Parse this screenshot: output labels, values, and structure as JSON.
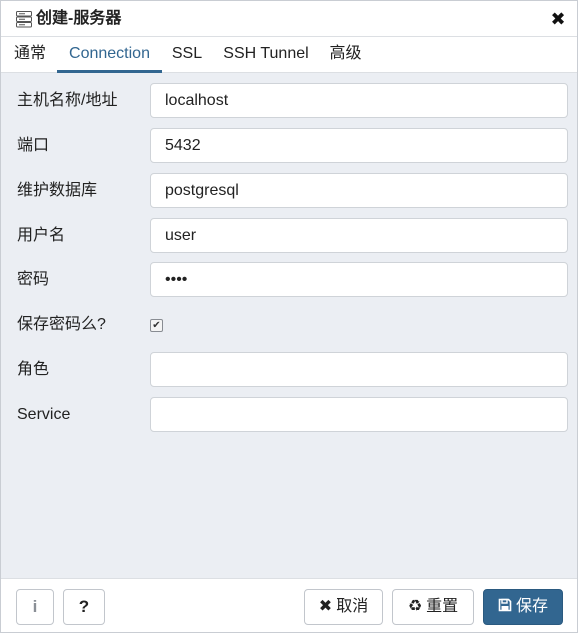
{
  "dialog": {
    "title": "创建-服务器",
    "icon": "server-icon",
    "close_icon": "close-icon"
  },
  "tabs": [
    {
      "label": "通常",
      "active": false
    },
    {
      "label": "Connection",
      "active": true
    },
    {
      "label": "SSL",
      "active": false
    },
    {
      "label": "SSH Tunnel",
      "active": false
    },
    {
      "label": "高级",
      "active": false
    }
  ],
  "form": {
    "host": {
      "label": "主机名称/地址",
      "value": "localhost"
    },
    "port": {
      "label": "端口",
      "value": "5432"
    },
    "maintenance_db": {
      "label": "维护数据库",
      "value": "postgresql"
    },
    "username": {
      "label": "用户名",
      "value": "user"
    },
    "password": {
      "label": "密码",
      "value": "••••"
    },
    "save_password": {
      "label": "保存密码么?",
      "checked": true
    },
    "role": {
      "label": "角色",
      "value": ""
    },
    "service": {
      "label": "Service",
      "value": ""
    }
  },
  "footer": {
    "info_icon": "info-icon",
    "help_icon": "help-icon",
    "help_label": "?",
    "info_label": "i",
    "cancel_label": "取消",
    "reset_label": "重置",
    "save_label": "保存"
  },
  "colors": {
    "accent": "#326690",
    "body_background": "#ebeef3"
  }
}
